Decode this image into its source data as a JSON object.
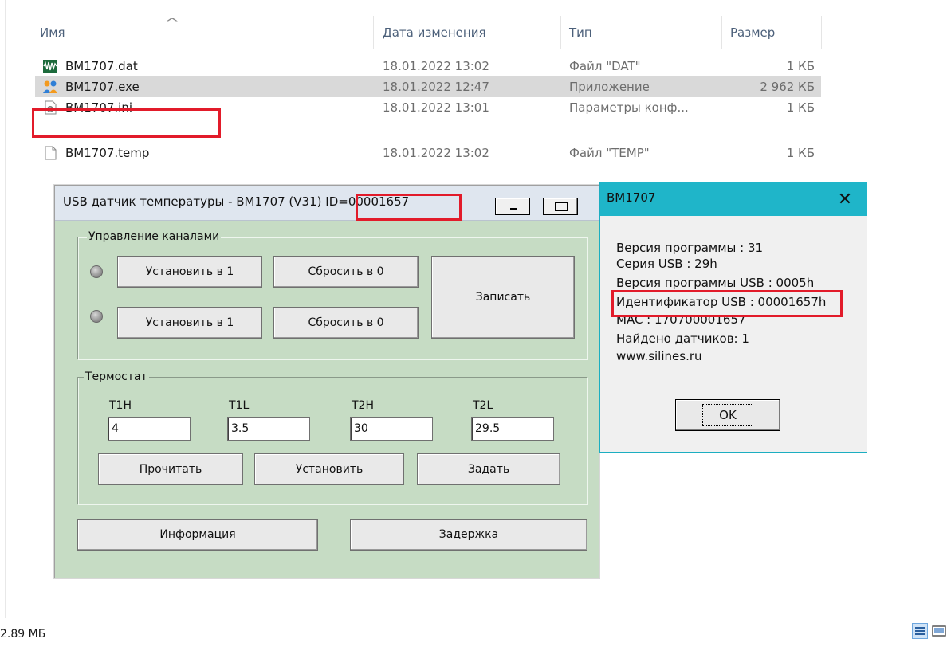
{
  "explorer": {
    "columns": {
      "name": "Имя",
      "date": "Дата изменения",
      "type": "Тип",
      "size": "Размер"
    },
    "files": [
      {
        "name": "BM1707.dat",
        "date": "18.01.2022 13:02",
        "type": "Файл \"DAT\"",
        "size": "1 КБ",
        "icon": "waveform-icon"
      },
      {
        "name": "BM1707.exe",
        "date": "18.01.2022 12:47",
        "type": "Приложение",
        "size": "2 962 КБ",
        "icon": "app-people-icon",
        "selected": true
      },
      {
        "name": "BM1707.ini",
        "date": "18.01.2022 13:01",
        "type": "Параметры конф...",
        "size": "1 КБ",
        "icon": "config-gear-file-icon"
      },
      {
        "name": "BM1707.temp",
        "date": "18.01.2022 13:02",
        "type": "Файл \"TEMP\"",
        "size": "1 КБ",
        "icon": "blank-file-icon"
      }
    ],
    "status": "2.89 МБ"
  },
  "app": {
    "title_prefix": "USB датчик температуры - BM1707 (V31)",
    "title_id": "ID=00001657",
    "channels": {
      "group_label": "Управление каналами",
      "set_label": "Установить в 1",
      "reset_label": "Сбросить в 0",
      "write_label": "Записать"
    },
    "thermostat": {
      "group_label": "Термостат",
      "fields": [
        {
          "label": "T1H",
          "value": "4"
        },
        {
          "label": "T1L",
          "value": "3.5"
        },
        {
          "label": "T2H",
          "value": "30"
        },
        {
          "label": "T2L",
          "value": "29.5"
        }
      ],
      "read_label": "Прочитать",
      "install_label": "Установить",
      "assign_label": "Задать"
    },
    "info_label": "Информация",
    "delay_label": "Задержка"
  },
  "dialog": {
    "title": "BM1707",
    "lines": [
      "Версия программы : 31",
      "Серия USB : 29h",
      "Версия программы USB : 0005h",
      "Идентификатор USB : 00001657h",
      "MAC : 170700001657",
      "Найдено датчиков: 1",
      "www.silines.ru"
    ],
    "ok_label": "OK"
  },
  "colors": {
    "highlight": "#e21b2a",
    "dialog_title": "#1fb5c9",
    "app_bg": "#c6dcc4"
  }
}
